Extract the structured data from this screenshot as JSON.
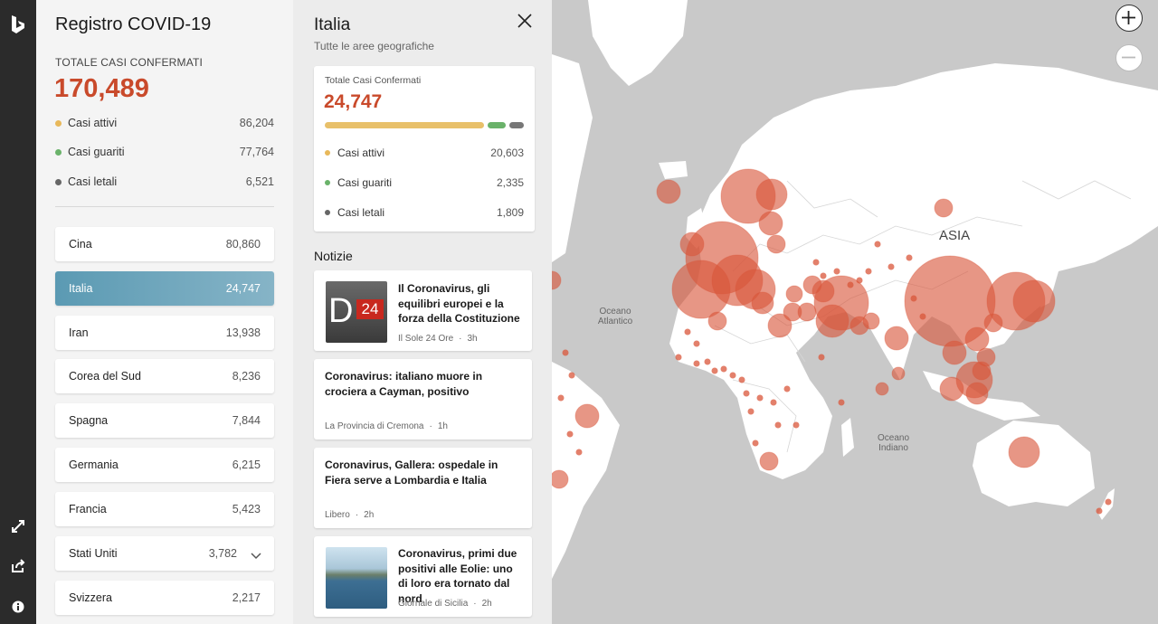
{
  "rail": {
    "icons": [
      "bing-logo-icon",
      "expand-icon",
      "share-icon",
      "info-icon"
    ]
  },
  "summary": {
    "title": "Registro COVID-19",
    "total_label": "TOTALE CASI CONFERMATI",
    "total": "170,489",
    "stats": [
      {
        "label": "Casi attivi",
        "value": "86,204",
        "color": "#e8b85a"
      },
      {
        "label": "Casi guariti",
        "value": "77,764",
        "color": "#6ab26a"
      },
      {
        "label": "Casi letali",
        "value": "6,521",
        "color": "#666666"
      }
    ]
  },
  "countries": [
    {
      "name": "Cina",
      "value": "80,860"
    },
    {
      "name": "Italia",
      "value": "24,747"
    },
    {
      "name": "Iran",
      "value": "13,938"
    },
    {
      "name": "Corea del Sud",
      "value": "8,236"
    },
    {
      "name": "Spagna",
      "value": "7,844"
    },
    {
      "name": "Germania",
      "value": "6,215"
    },
    {
      "name": "Francia",
      "value": "5,423"
    },
    {
      "name": "Stati Uniti",
      "value": "3,782"
    },
    {
      "name": "Svizzera",
      "value": "2,217"
    }
  ],
  "detail": {
    "title": "Italia",
    "subtitle": "Tutte le aree geografiche",
    "card_label": "Totale Casi Confermati",
    "total": "24,747",
    "breakdown": {
      "active": 20603,
      "recovered": 2335,
      "deaths": 1809
    },
    "stats": [
      {
        "label": "Casi attivi",
        "value": "20,603",
        "color": "#e8b85a"
      },
      {
        "label": "Casi guariti",
        "value": "2,335",
        "color": "#6ab26a"
      },
      {
        "label": "Casi letali",
        "value": "1,809",
        "color": "#666666"
      }
    ],
    "news_heading": "Notizie",
    "news": [
      {
        "title": "Il Coronavirus, gli equilibri europei e la forza della Costituzione",
        "source": "Il Sole 24 Ore",
        "time": "3h",
        "thumb": "D24",
        "thumb_sup": "24"
      },
      {
        "title": "Coronavirus: italiano muore in crociera a Cayman, positivo",
        "source": "La Provincia di Cremona",
        "time": "1h"
      },
      {
        "title": "Coronavirus, Gallera: ospedale in Fiera serve a Lombardia e Italia",
        "source": "Libero",
        "time": "2h"
      },
      {
        "title": "Coronavirus, primi due positivi alle Eolie: uno di loro era tornato dal nord",
        "source": "Giornale di Sicilia",
        "time": "2h"
      }
    ]
  },
  "map": {
    "labels": {
      "asia": "ASIA",
      "atlantic": "Oceano Atlantico",
      "indian": "Oceano Indiano"
    },
    "bubble_color": "#d9553a",
    "land_color": "#ffffff",
    "sea_color": "#c9c9c9"
  },
  "zoom": {
    "in_icon": "zoom-in-icon",
    "out_icon": "zoom-out-icon"
  }
}
